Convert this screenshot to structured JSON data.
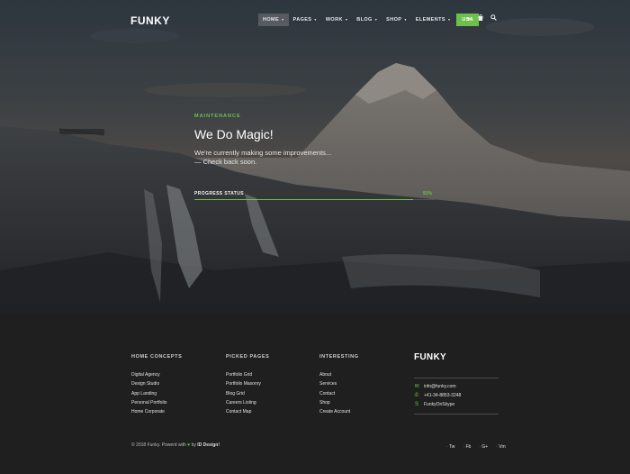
{
  "header": {
    "logo": "FUNKY",
    "nav": [
      {
        "label": "HOME",
        "has_caret": true,
        "active": true
      },
      {
        "label": "PAGES",
        "has_caret": true,
        "active": false
      },
      {
        "label": "WORK",
        "has_caret": true,
        "active": false
      },
      {
        "label": "BLOG",
        "has_caret": true,
        "active": false
      },
      {
        "label": "SHOP",
        "has_caret": true,
        "active": false
      },
      {
        "label": "ELEMENTS",
        "has_caret": true,
        "active": false
      }
    ],
    "cta": "USA",
    "icons": [
      "heart-icon",
      "bag-icon",
      "search-icon"
    ],
    "caret": "▾"
  },
  "hero": {
    "eyebrow": "MAINTENANCE",
    "title": "We Do Magic!",
    "subtitle_line1": "We're currently making some improvements...",
    "subtitle_line2": "— Check back soon.",
    "progress": {
      "label": "PROGRESS STATUS",
      "value_text": "91%",
      "fraction": 0.91
    }
  },
  "footer": {
    "columns": [
      {
        "title": "HOME CONCEPTS",
        "items": [
          "Digital Agency",
          "Design Studio",
          "App Landing",
          "Personal Portfolio",
          "Home Corporate"
        ]
      },
      {
        "title": "PICKED PAGES",
        "items": [
          "Portfolio Grid",
          "Portfolio Masonry",
          "Blog Grid",
          "Careers Listing",
          "Contact Map"
        ]
      },
      {
        "title": "INTERESTING",
        "items": [
          "About",
          "Services",
          "Contact",
          "Shop",
          "Create Account"
        ]
      }
    ],
    "brand": "FUNKY",
    "contacts": [
      {
        "icon": "mail-icon",
        "glyph": "✉",
        "text": "info@funky.com"
      },
      {
        "icon": "phone-icon",
        "glyph": "✆",
        "text": "+41-34-8853-3248"
      },
      {
        "icon": "skype-icon",
        "glyph": "S",
        "text": "FunkyOnSkype"
      }
    ],
    "copyright_prefix": "© 2018 Funky. Powerd with",
    "copyright_by": "by",
    "copyright_author": "ID Design!",
    "social": [
      "Tw",
      "Fb",
      "G+",
      "Vm"
    ]
  },
  "colors": {
    "accent": "#6ec04c",
    "footer_bg": "#1f1f1f"
  }
}
